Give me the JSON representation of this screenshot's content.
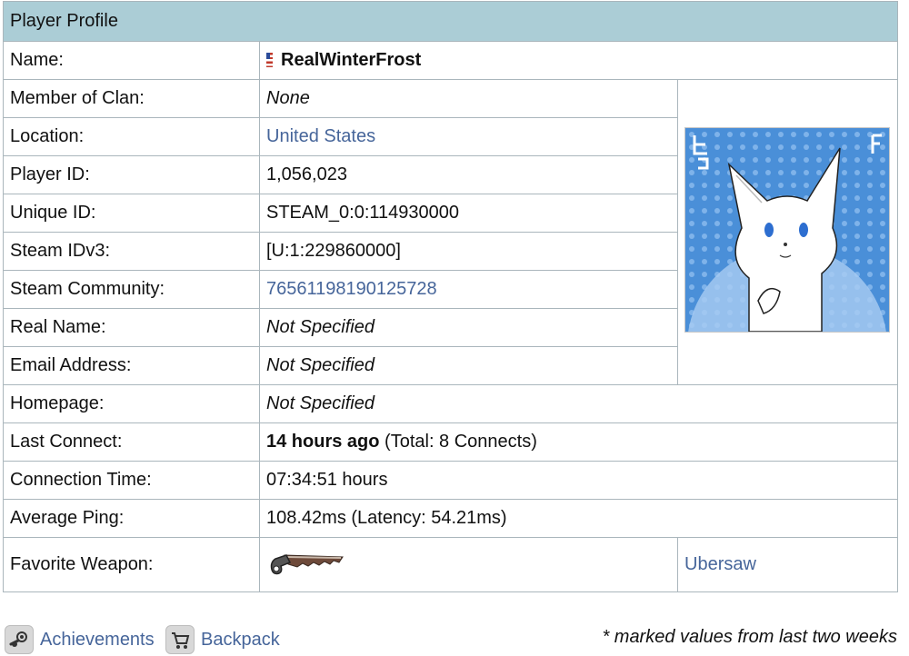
{
  "panel": {
    "title": "Player Profile"
  },
  "profile": {
    "name_label": "Name:",
    "name_value": "RealWinterFrost",
    "rows": [
      {
        "label": "Member of Clan:",
        "value": "None"
      },
      {
        "label": "Location:",
        "value": "United States"
      },
      {
        "label": "Player ID:",
        "value": "1,056,023"
      },
      {
        "label": "Unique ID:",
        "value": "STEAM_0:0:114930000"
      },
      {
        "label": "Steam IDv3:",
        "value": "[U:1:229860000]"
      },
      {
        "label": "Steam Community:",
        "value": "76561198190125728"
      },
      {
        "label": "Real Name:",
        "value": "Not Specified"
      },
      {
        "label": "Email Address:",
        "value": "Not Specified"
      },
      {
        "label": "Homepage:",
        "value": "Not Specified"
      },
      {
        "label": "Last Connect:",
        "value_bold": "14 hours ago",
        "value_rest": " (Total: 8 Connects)"
      },
      {
        "label": "Connection Time:",
        "value": "07:34:51 hours"
      },
      {
        "label": "Average Ping:",
        "value": "108.42ms (Latency: 54.21ms)"
      },
      {
        "label": "Favorite Weapon:",
        "weapon_name": "Ubersaw"
      }
    ]
  },
  "footer": {
    "achievements_label": "Achievements",
    "backpack_label": "Backpack",
    "note": "* marked values from last two weeks"
  },
  "icons": {
    "flag": "us-flag-icon",
    "achievements": "steam-icon",
    "backpack": "cart-icon",
    "weapon": "ubersaw-weapon-icon"
  },
  "colors": {
    "header_bg": "#abcdd6",
    "link": "#46659a",
    "border": "#aab6bc"
  }
}
